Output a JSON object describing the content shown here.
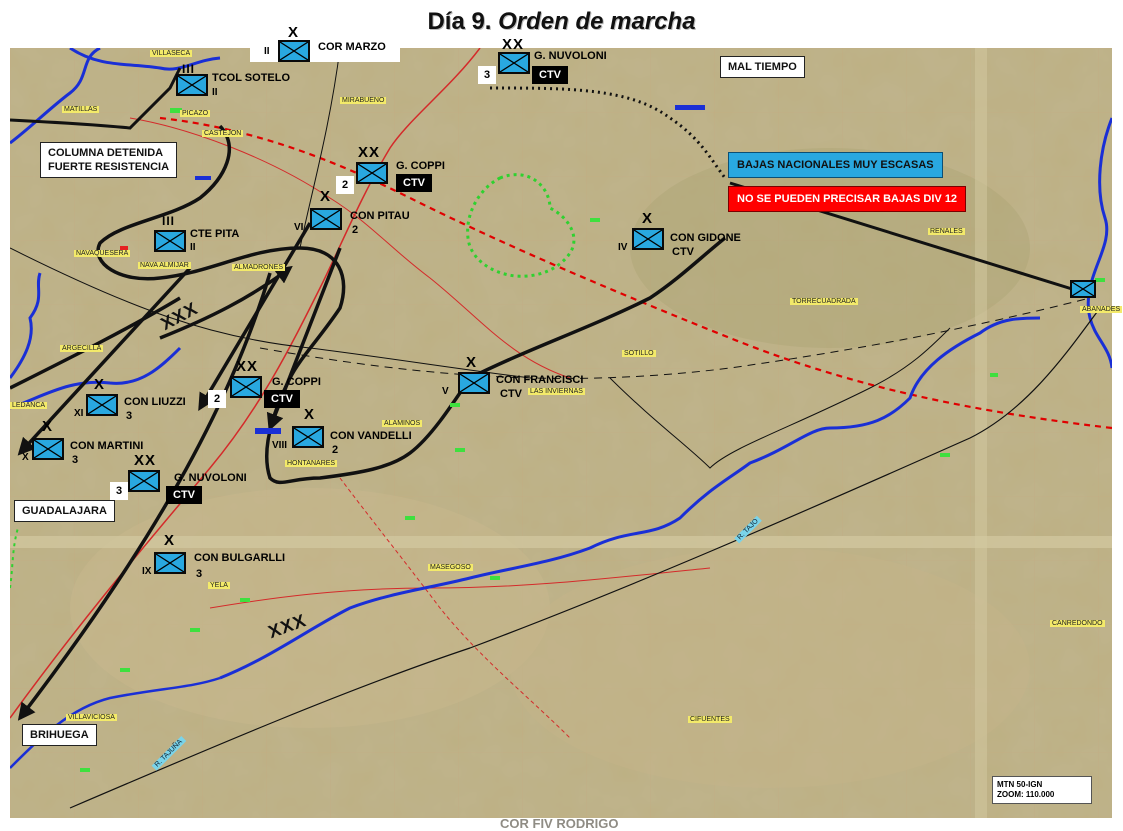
{
  "title": {
    "prefix": "Día 9.",
    "main": "Orden de marcha"
  },
  "callouts": {
    "mal_tiempo": "MAL TIEMPO",
    "columna_line1": "COLUMNA DETENIDA",
    "columna_line2": "FUERTE RESISTENCIA",
    "bajas_nacionales": "BAJAS NACIONALES MUY ESCASAS",
    "no_bajas_div12": "NO SE PUEDEN PRECISAR BAJAS DIV 12",
    "guadalajara": "GUADALAJARA",
    "brihuega": "BRIHUEGA"
  },
  "units": [
    {
      "id": "cor-marzo",
      "size": "X",
      "num": "II",
      "name": "COR MARZO",
      "extra": ""
    },
    {
      "id": "tcol-sotelo",
      "size": "III",
      "num": "II",
      "name": "TCOL SOTELO",
      "extra": ""
    },
    {
      "id": "g-nuvoloni-top",
      "size": "XX",
      "num": "3",
      "name": "G. NUVOLONI",
      "extra": "CTV"
    },
    {
      "id": "g-coppi-top",
      "size": "XX",
      "num": "2",
      "name": "G. COPPI",
      "extra": "CTV"
    },
    {
      "id": "con-pitau",
      "size": "X",
      "num": "VI",
      "name": "CON PITAU",
      "extra": "2"
    },
    {
      "id": "cte-pita",
      "size": "III",
      "num": "II",
      "name": "CTE PITA",
      "extra": ""
    },
    {
      "id": "con-gidone",
      "size": "X",
      "num": "IV",
      "name": "CON  GIDONE",
      "extra": "CTV"
    },
    {
      "id": "g-coppi-mid",
      "size": "XX",
      "num": "2",
      "name": "G. COPPI",
      "extra": "CTV"
    },
    {
      "id": "con-francisci",
      "size": "X",
      "num": "V",
      "name": "CON  FRANCISCI",
      "extra": "CTV"
    },
    {
      "id": "con-liuzzi",
      "size": "X",
      "num": "XI",
      "name": "CON LIUZZI",
      "extra": "3"
    },
    {
      "id": "con-martini",
      "size": "X",
      "num": "X",
      "name": "CON MARTINI",
      "extra": "3"
    },
    {
      "id": "con-vandelli",
      "size": "X",
      "num": "VIII",
      "name": "CON VANDELLI",
      "extra": "2"
    },
    {
      "id": "g-nuvoloni-bot",
      "size": "XX",
      "num": "3",
      "name": "G. NUVOLONI",
      "extra": "CTV"
    },
    {
      "id": "con-bulgarlli",
      "size": "X",
      "num": "IX",
      "name": "CON BULGARLLI",
      "extra": "3"
    },
    {
      "id": "unit-far-right",
      "size": "",
      "num": "",
      "name": "",
      "extra": ""
    }
  ],
  "front_labels": [
    "XXX",
    "XXX"
  ],
  "places": [
    "VILLASECA",
    "MATILLAS",
    "CASTEJON",
    "MIRABUENO",
    "NAVAQUESERA",
    "NAVA ALMIJAR",
    "ALMADRONES",
    "ARGECILLA",
    "HONTANARES",
    "ALAMINOS",
    "LAS INVIERNAS",
    "SOTILLO",
    "TORRECUADRADA",
    "RENALES",
    "ABANADES",
    "MASEGOSO",
    "CIFUENTES",
    "VILLAVICIOSA",
    "YELA",
    "CANREDONDO",
    "LEDANCA",
    "PICAZO"
  ],
  "river_tags": [
    "R. TAJUÑA",
    "R. TAJO"
  ],
  "credit": "COR FIV RODRIGO",
  "scale_box": {
    "line1": "MTN 50-IGN",
    "line2": "ZOOM: 110.000"
  },
  "colors": {
    "unit_fill": "#29a8e0",
    "river": "#1a2fd6",
    "front_red": "#e00000",
    "green_border": "#2fd12f"
  }
}
